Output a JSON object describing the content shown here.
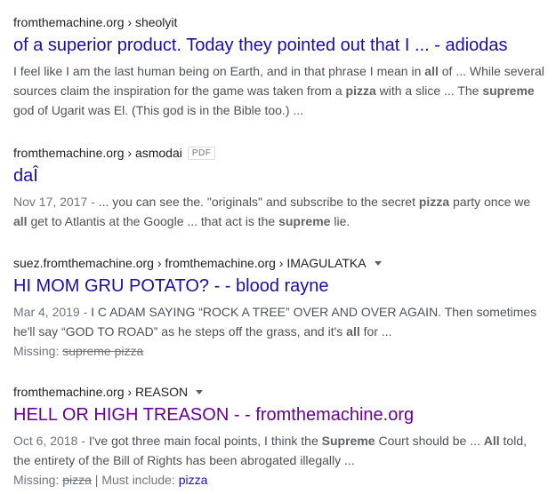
{
  "results": [
    {
      "breadcrumb": "fromthemachine.org › sheolyit",
      "title": "of a superior product. Today they pointed out that I ... - adiodas",
      "visited": false,
      "snippet": [
        {
          "t": "I feel like I am the last human being on Earth, and in that phrase I mean in "
        },
        {
          "t": "all",
          "b": true
        },
        {
          "t": " of ... While several sources claim the inspiration for the game was taken from a "
        },
        {
          "t": "pizza",
          "b": true
        },
        {
          "t": " with a slice ... The "
        },
        {
          "t": "supreme",
          "b": true
        },
        {
          "t": " god of Ugarit was El. (This god is in the Bible too.) ..."
        }
      ]
    },
    {
      "breadcrumb": "fromthemachine.org › asmodai",
      "badge": "PDF",
      "title": "daÎ",
      "visited": false,
      "date": "Nov 17, 2017 - ",
      "snippet": [
        {
          "t": "... you can see the. \"originals\" and subscribe to the secret "
        },
        {
          "t": "pizza",
          "b": true
        },
        {
          "t": " party once we "
        },
        {
          "t": "all",
          "b": true
        },
        {
          "t": " get to Atlantis at the Google ... that act is the "
        },
        {
          "t": "supreme",
          "b": true
        },
        {
          "t": " lie."
        }
      ]
    },
    {
      "breadcrumb": "suez.fromthemachine.org › fromthemachine.org › IMAGULATKA",
      "has_menu": true,
      "title": "HI MOM GRU POTATO? - - blood rayne",
      "visited": false,
      "date": "Mar 4, 2019 - ",
      "snippet": [
        {
          "t": "I C ADAM SAYING “ROCK A TREE” OVER AND OVER AGAIN. Then sometimes he'll say “GOD TO ROAD” as he steps off the grass, and it's "
        },
        {
          "t": "all",
          "b": true
        },
        {
          "t": " for ..."
        }
      ],
      "missing_label": "Missing: ",
      "missing_terms": "supreme pizza"
    },
    {
      "breadcrumb": "fromthemachine.org › REASON",
      "has_menu": true,
      "title": "HELL OR HIGH TREASON - - fromthemachine.org",
      "visited": true,
      "date": "Oct 6, 2018 - ",
      "snippet": [
        {
          "t": "I've got three main focal points, I think the "
        },
        {
          "t": "Supreme",
          "b": true
        },
        {
          "t": " Court should be ... "
        },
        {
          "t": "All",
          "b": true
        },
        {
          "t": " told, the entirety of the Bill of Rights has been abrogated illegally ..."
        }
      ],
      "missing_label": "Missing: ",
      "missing_terms": "pizza",
      "must_include_label": " | Must include: ",
      "must_include_term": "pizza"
    }
  ],
  "colors": {
    "link": "#1a0dab",
    "visited": "#660099",
    "snippet": "#4d5156",
    "meta": "#70757a"
  }
}
